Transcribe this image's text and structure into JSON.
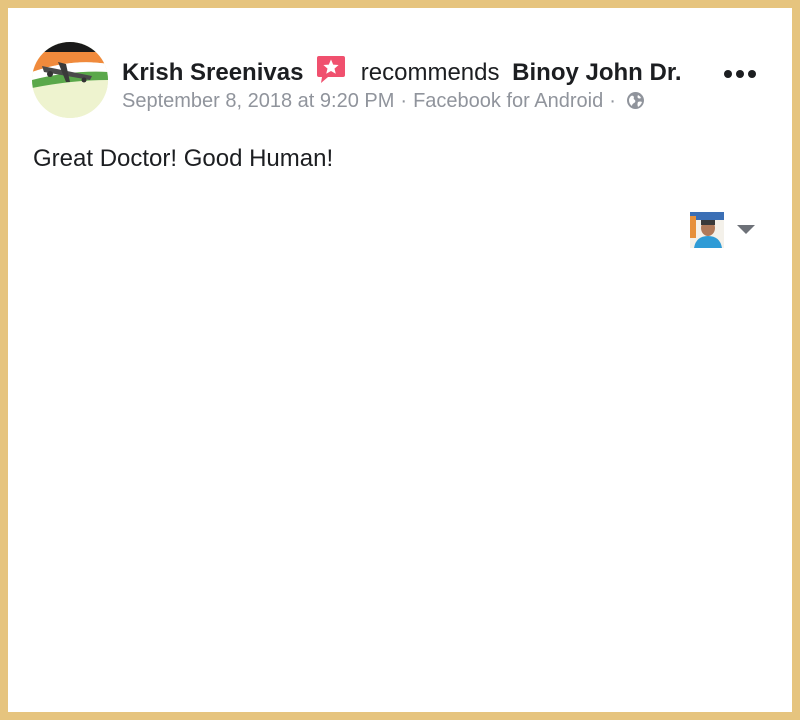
{
  "post": {
    "author_name": "Krish Sreenivas",
    "action_verb": "recommends",
    "page_name": "Binoy John Dr.",
    "timestamp": "September 8, 2018 at 9:20 PM",
    "separator": "·",
    "source": "Facebook for Android",
    "privacy_icon": "globe-icon",
    "body_text": "Great Doctor! Good Human!"
  },
  "icons": {
    "recommendation_badge": "recommendation-star-icon",
    "more_options": "more-options-icon",
    "dropdown": "chevron-down-icon"
  },
  "colors": {
    "frame_border": "#e6c47e",
    "text_primary": "#1c1e21",
    "text_secondary": "#90949c",
    "badge_pink": "#f0506e"
  }
}
